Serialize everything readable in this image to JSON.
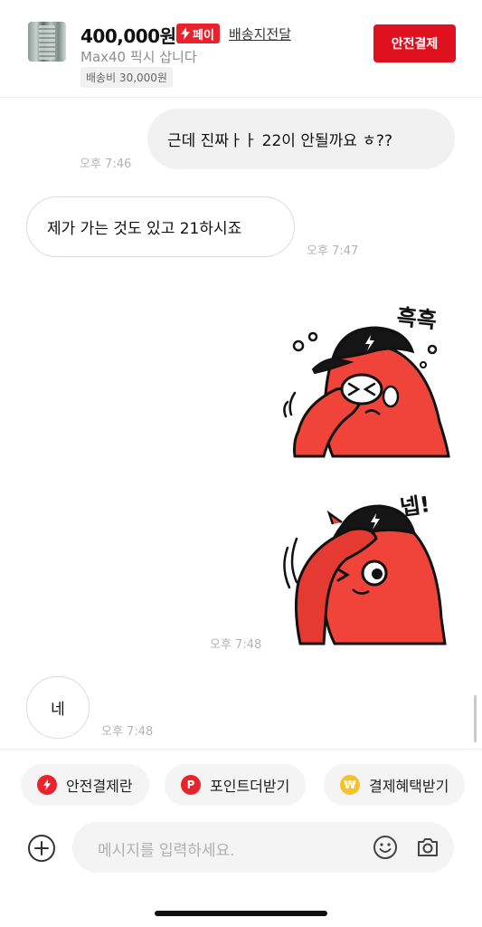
{
  "header": {
    "price": "400,000원",
    "pay_badge": "페이",
    "shipping_direct": "배송지전달",
    "subtitle": "Max40 픽시 삽니다",
    "shipping_fee": "배송비 30,000원",
    "safe_pay_button": "안전결제"
  },
  "messages": [
    {
      "type": "sent",
      "text": "근데 진짜ㅏㅏ 22이 안될까요 ㅎ??",
      "time": "오후 7:46"
    },
    {
      "type": "received",
      "text": "제가 가는 것도 있고 21하시죠",
      "time": "오후 7:47"
    },
    {
      "type": "sticker",
      "caption": "흑흑",
      "time": ""
    },
    {
      "type": "sticker",
      "caption": "넵!",
      "time": "오후 7:48"
    },
    {
      "type": "received",
      "text": "네",
      "time": "오후 7:48"
    }
  ],
  "quick_actions": [
    {
      "label": "안전결제란",
      "icon": "lightning-icon",
      "color": "#e8232d"
    },
    {
      "label": "포인트더받기",
      "icon": "point-p-icon",
      "color": "#e8232d"
    },
    {
      "label": "결제혜택받기",
      "icon": "won-coin-icon",
      "color": "#f5c22b"
    }
  ],
  "composer": {
    "placeholder": "메시지를 입력하세요."
  },
  "colors": {
    "accent_red": "#e0111e",
    "sticker_red": "#f0433a",
    "bubble_sent_bg": "#f1f1f1",
    "timestamp": "#b3b3b3"
  }
}
